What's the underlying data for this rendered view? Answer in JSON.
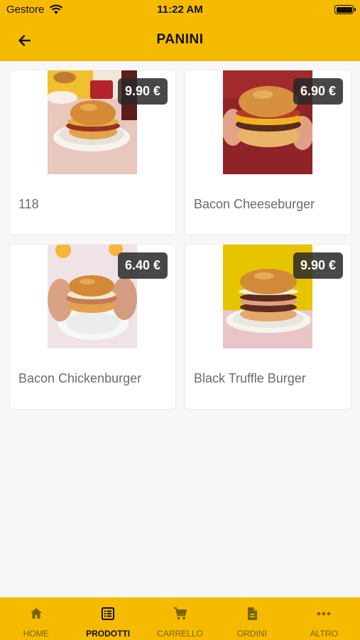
{
  "status_bar": {
    "carrier": "Gestore",
    "time": "11:22 AM",
    "wifi_icon": "wifi-icon",
    "battery_icon": "battery-icon"
  },
  "header": {
    "title": "PANINI",
    "back_icon": "arrow-left-icon"
  },
  "colors": {
    "brand_yellow": "#f6bb00",
    "price_badge": "#282828",
    "background": "#f7f7f7"
  },
  "products": [
    {
      "name": "118",
      "price": "9.90 €",
      "image": "burger-photo-118"
    },
    {
      "name": "Bacon Cheeseburger",
      "price": "6.90 €",
      "image": "burger-photo-bacon-cheeseburger"
    },
    {
      "name": "Bacon Chickenburger",
      "price": "6.40 €",
      "image": "burger-photo-bacon-chickenburger"
    },
    {
      "name": "Black Truffle Burger",
      "price": "9.90 €",
      "image": "burger-photo-black-truffle"
    }
  ],
  "tabs": [
    {
      "label": "HOME",
      "icon": "home-icon",
      "active": false
    },
    {
      "label": "PRODOTTI",
      "icon": "list-icon",
      "active": true
    },
    {
      "label": "CARRELLO",
      "icon": "cart-icon",
      "active": false
    },
    {
      "label": "ORDINI",
      "icon": "document-icon",
      "active": false
    },
    {
      "label": "ALTRO",
      "icon": "more-icon",
      "active": false
    }
  ]
}
